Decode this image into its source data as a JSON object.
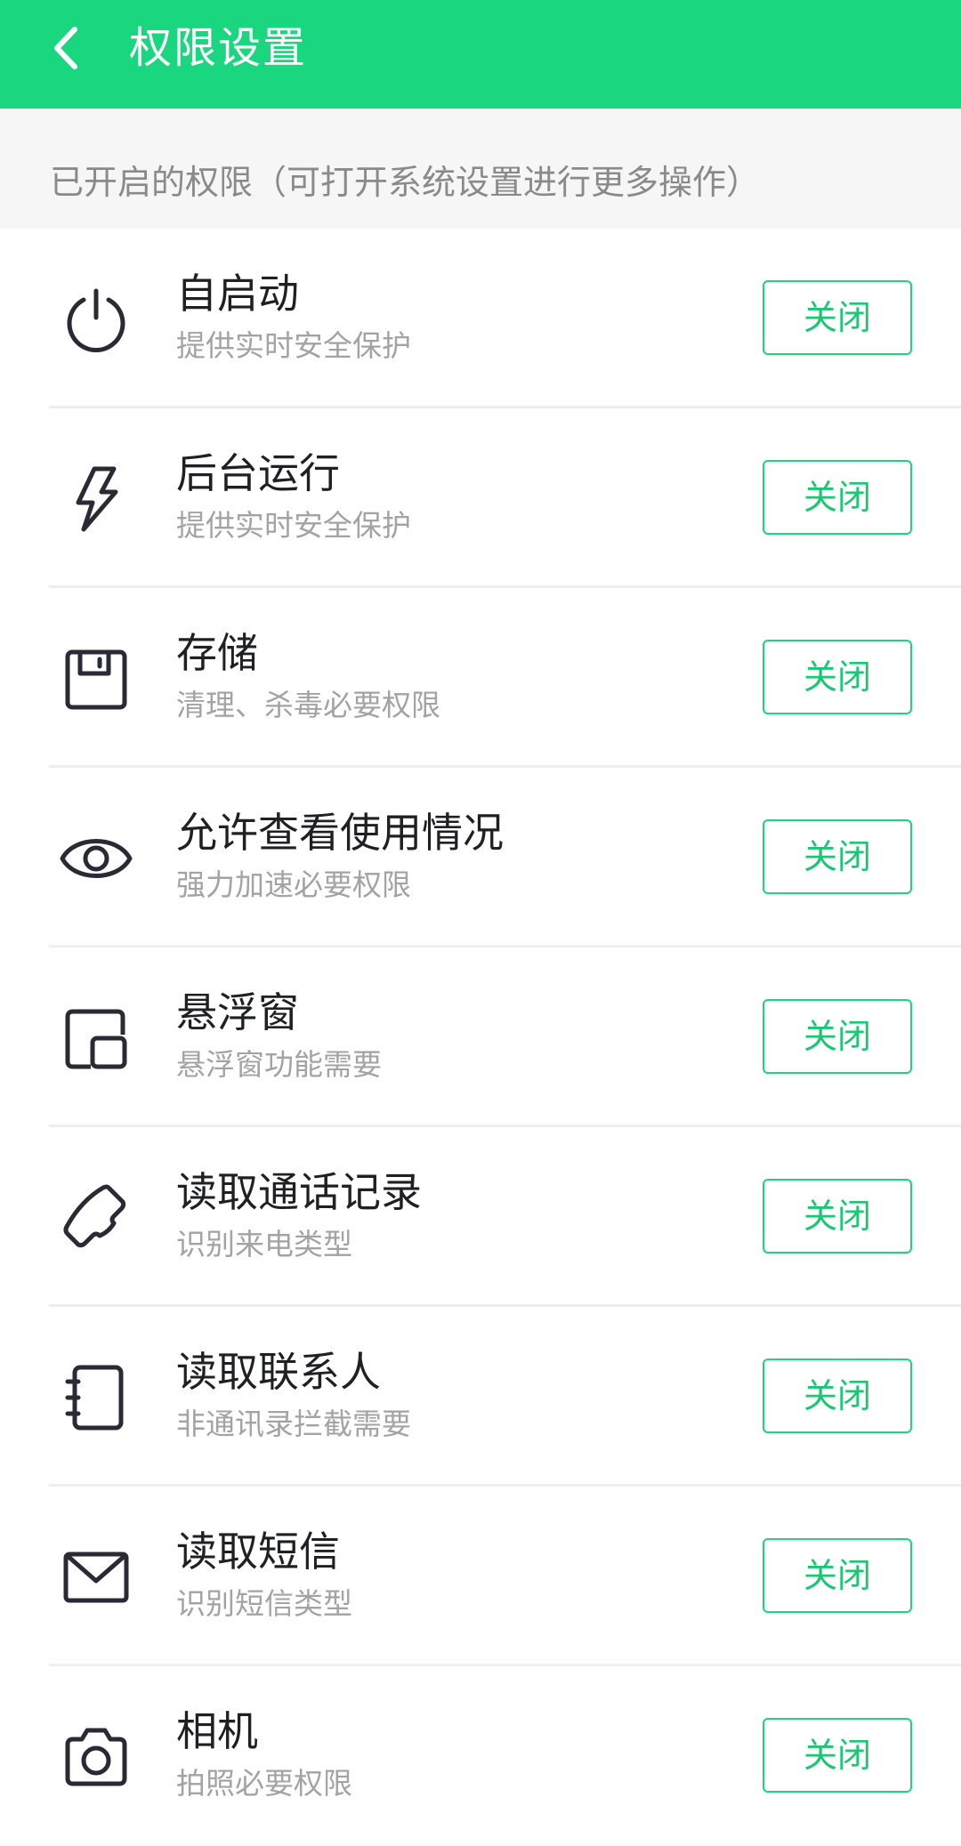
{
  "header": {
    "title": "权限设置",
    "background_color": "#1ad67e",
    "back_icon": "chevron-left-icon"
  },
  "section": {
    "title": "已开启的权限（可打开系统设置进行更多操作）"
  },
  "accent_color": "#1ad67e",
  "permissions": [
    {
      "icon": "power-icon",
      "title": "自启动",
      "subtitle": "提供实时安全保护",
      "button_label": "关闭"
    },
    {
      "icon": "lightning-icon",
      "title": "后台运行",
      "subtitle": "提供实时安全保护",
      "button_label": "关闭"
    },
    {
      "icon": "floppy-disk-icon",
      "title": "存储",
      "subtitle": "清理、杀毒必要权限",
      "button_label": "关闭"
    },
    {
      "icon": "eye-icon",
      "title": "允许查看使用情况",
      "subtitle": "强力加速必要权限",
      "button_label": "关闭"
    },
    {
      "icon": "floating-window-icon",
      "title": "悬浮窗",
      "subtitle": "悬浮窗功能需要",
      "button_label": "关闭"
    },
    {
      "icon": "phone-icon",
      "title": "读取通话记录",
      "subtitle": "识别来电类型",
      "button_label": "关闭"
    },
    {
      "icon": "contacts-book-icon",
      "title": "读取联系人",
      "subtitle": "非通讯录拦截需要",
      "button_label": "关闭"
    },
    {
      "icon": "envelope-icon",
      "title": "读取短信",
      "subtitle": "识别短信类型",
      "button_label": "关闭"
    },
    {
      "icon": "camera-icon",
      "title": "相机",
      "subtitle": "拍照必要权限",
      "button_label": "关闭"
    }
  ]
}
